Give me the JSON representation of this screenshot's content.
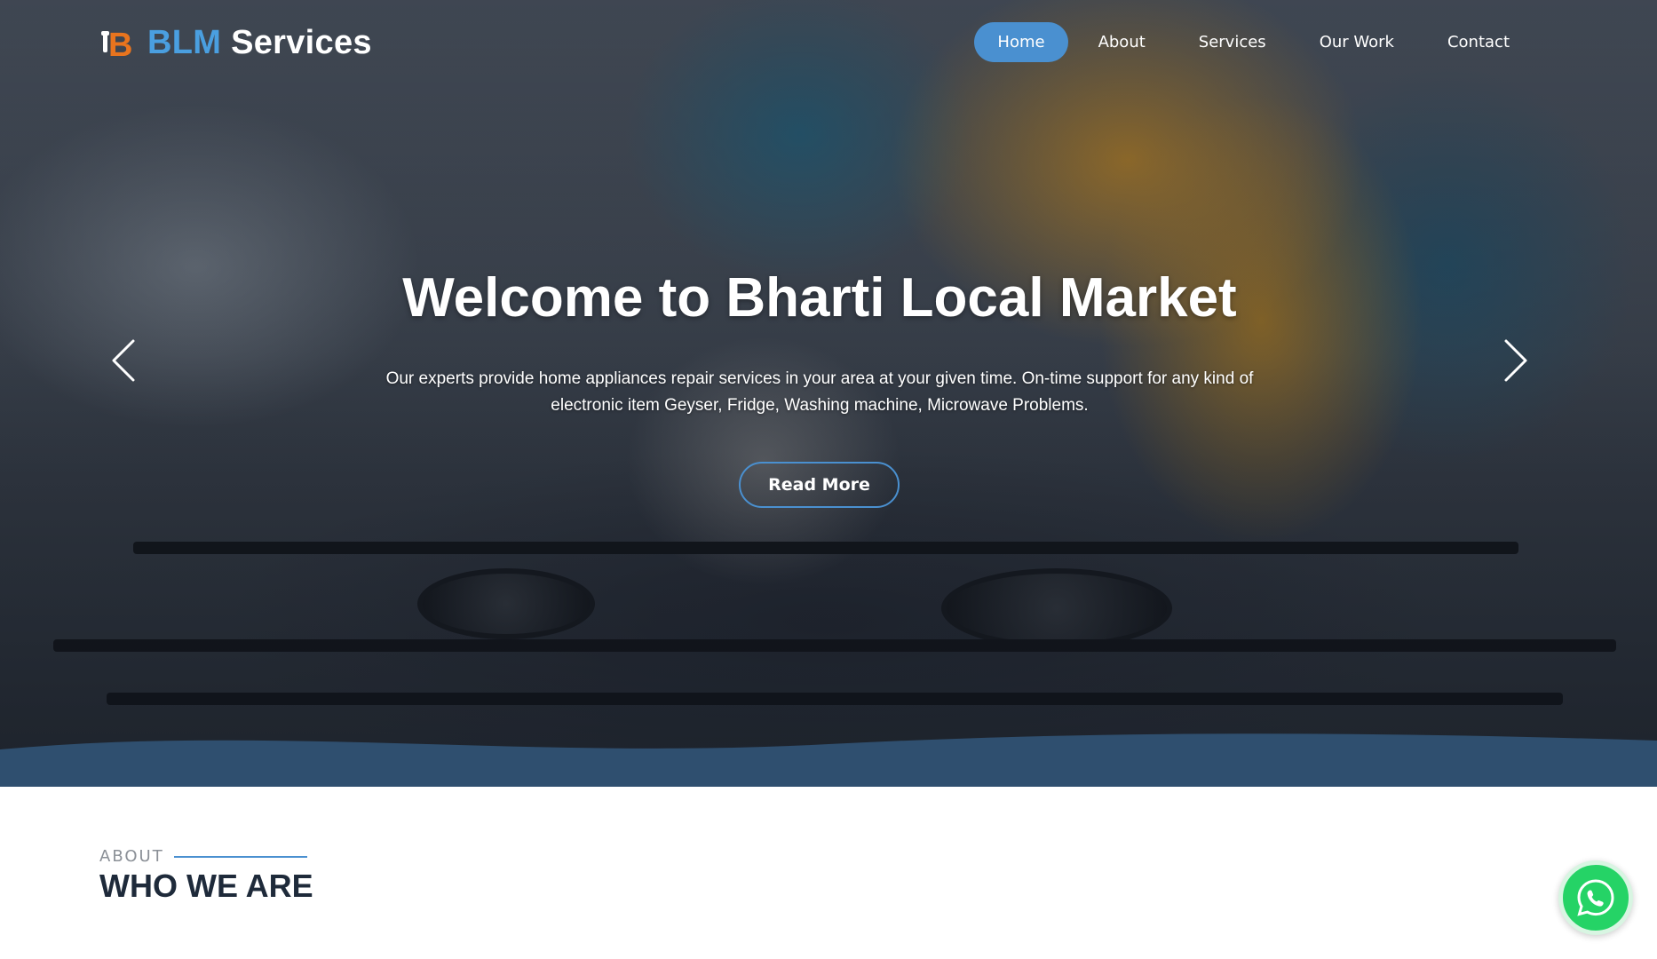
{
  "brand": {
    "name_accent": "BLM",
    "name_rest": "Services",
    "logo_letter": "B"
  },
  "nav": {
    "items": [
      {
        "label": "Home",
        "active": true
      },
      {
        "label": "About",
        "active": false
      },
      {
        "label": "Services",
        "active": false
      },
      {
        "label": "Our Work",
        "active": false
      },
      {
        "label": "Contact",
        "active": false
      }
    ]
  },
  "hero": {
    "title": "Welcome to Bharti Local Market",
    "description": "Our experts provide home appliances repair services in your area at your given time. On-time support for any kind of electronic item Geyser, Fridge, Washing machine, Microwave Problems.",
    "cta_label": "Read More",
    "prev_icon": "chevron-left-icon",
    "next_icon": "chevron-right-icon"
  },
  "about": {
    "label": "ABOUT",
    "title": "WHO WE ARE"
  },
  "whatsapp": {
    "icon": "whatsapp-icon"
  },
  "colors": {
    "accent": "#4a90d0",
    "brand_blue": "#4a9fe0",
    "dark_band": "#2f4f6f",
    "whatsapp": "#25d366",
    "heading": "#1e2a3a"
  }
}
